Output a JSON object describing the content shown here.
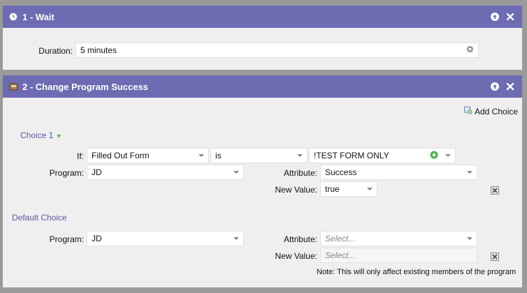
{
  "steps": [
    {
      "title": "1 - Wait",
      "duration_label": "Duration:",
      "duration_value": "5 minutes"
    },
    {
      "title": "2 - Change Program Success",
      "add_choice_label": "Add Choice",
      "choice1": {
        "title": "Choice 1",
        "if_label": "If:",
        "trigger_value": "Filled Out Form",
        "operator_value": "is",
        "form_value": "!TEST FORM ONLY",
        "program_label": "Program:",
        "program_value": "JD",
        "attribute_label": "Attribute:",
        "attribute_value": "Success",
        "new_value_label": "New Value:",
        "new_value_value": "true"
      },
      "default_choice": {
        "title": "Default Choice",
        "program_label": "Program:",
        "program_value": "JD",
        "attribute_label": "Attribute:",
        "attribute_placeholder": "Select...",
        "new_value_label": "New Value:",
        "new_value_placeholder": "Select..."
      },
      "note": "Note: This will only affect existing members of the program"
    }
  ],
  "colors": {
    "header": "#6d6bb2",
    "accent_text": "#5a58a8",
    "add_icon": "#4caf50"
  },
  "icons": [
    "clock-icon",
    "up-arrow-icon",
    "close-icon",
    "program-icon",
    "gear-icon",
    "add-choice-icon",
    "dropdown-caret-icon",
    "plus-circle-icon",
    "delete-icon"
  ]
}
